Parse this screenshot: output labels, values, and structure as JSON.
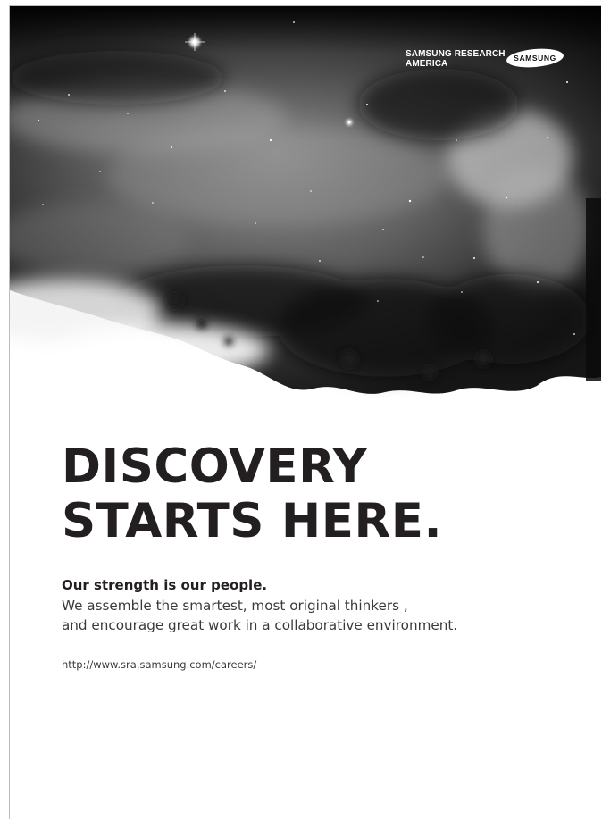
{
  "brand": {
    "research_name": "SAMSUNG RESEARCH\nAMERICA",
    "logo_text": "SAMSUNG"
  },
  "headline": {
    "line1": "DISCOVERY",
    "line2": "STARTS HERE."
  },
  "copy": {
    "tagline": "Our strength is our people.",
    "line1": "We assemble the smartest, most original thinkers ,",
    "line2": "and encourage great work in a collaborative environment.",
    "url": "http://www.sra.samsung.com/careers/"
  },
  "colors": {
    "headline": "#231f20",
    "body": "#3a3a3a",
    "background": "#ffffff",
    "logo_blue": "#1428a0"
  },
  "icons": {
    "logo": "samsung-logo-oval"
  }
}
